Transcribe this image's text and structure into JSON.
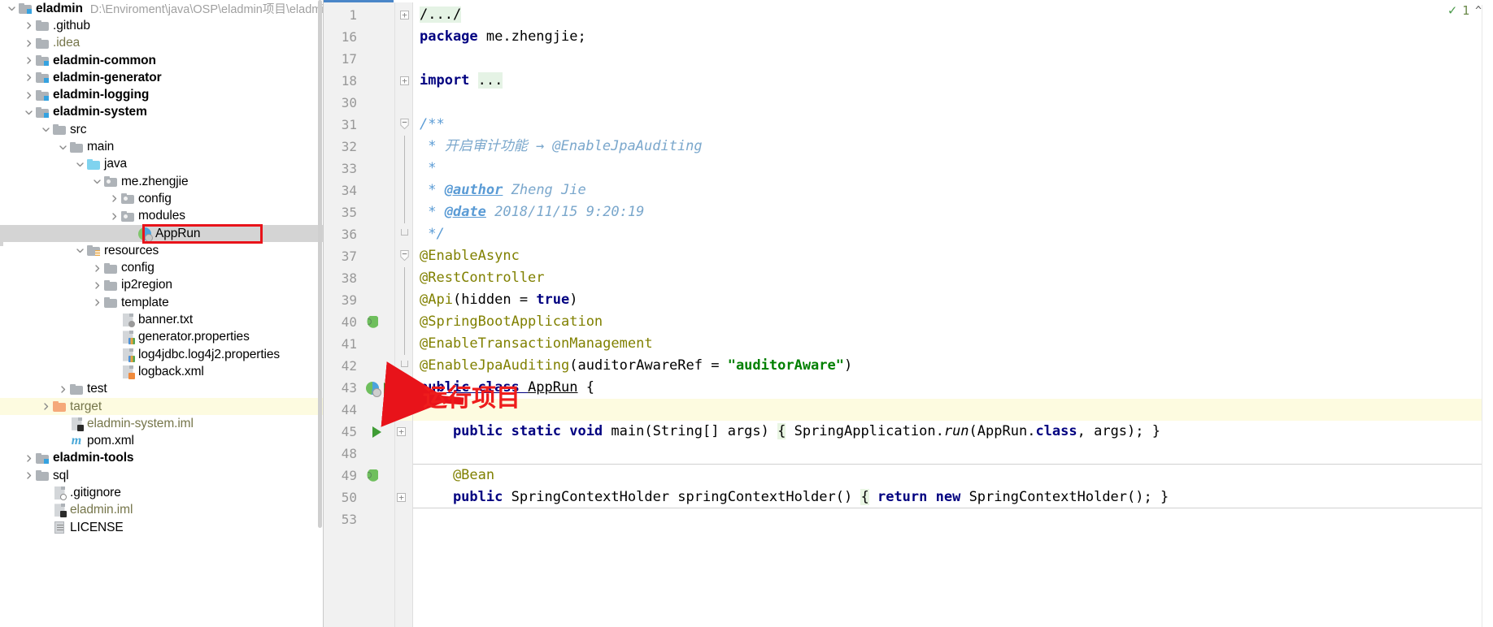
{
  "project_tree": {
    "root_path": "D:\\Enviroment\\java\\OSP\\eladmin项目\\eladmin\\e",
    "items": [
      {
        "label": "eladmin",
        "indent": 0,
        "arrow": "down",
        "icon": "module-folder",
        "style": "bold",
        "path": "D:\\Enviroment\\java\\OSP\\eladmin项目\\eladmin\\e"
      },
      {
        "label": ".github",
        "indent": 1,
        "arrow": "right",
        "icon": "folder",
        "style": "plain"
      },
      {
        "label": ".idea",
        "indent": 1,
        "arrow": "right",
        "icon": "folder",
        "style": "olive"
      },
      {
        "label": "eladmin-common",
        "indent": 1,
        "arrow": "right",
        "icon": "module-folder",
        "style": "bold"
      },
      {
        "label": "eladmin-generator",
        "indent": 1,
        "arrow": "right",
        "icon": "module-folder",
        "style": "bold"
      },
      {
        "label": "eladmin-logging",
        "indent": 1,
        "arrow": "right",
        "icon": "module-folder",
        "style": "bold"
      },
      {
        "label": "eladmin-system",
        "indent": 1,
        "arrow": "down",
        "icon": "module-folder",
        "style": "bold"
      },
      {
        "label": "src",
        "indent": 2,
        "arrow": "down",
        "icon": "folder",
        "style": "plain"
      },
      {
        "label": "main",
        "indent": 3,
        "arrow": "down",
        "icon": "folder",
        "style": "plain"
      },
      {
        "label": "java",
        "indent": 4,
        "arrow": "down",
        "icon": "source-folder",
        "style": "plain"
      },
      {
        "label": "me.zhengjie",
        "indent": 5,
        "arrow": "down",
        "icon": "package",
        "style": "plain"
      },
      {
        "label": "config",
        "indent": 6,
        "arrow": "right",
        "icon": "package",
        "style": "plain"
      },
      {
        "label": "modules",
        "indent": 6,
        "arrow": "right",
        "icon": "package",
        "style": "plain"
      },
      {
        "label": "AppRun",
        "indent": 7,
        "arrow": "none",
        "icon": "java-class",
        "style": "plain",
        "selected": true,
        "highlighted_box": true
      },
      {
        "label": "resources",
        "indent": 4,
        "arrow": "down",
        "icon": "resource-folder",
        "style": "plain"
      },
      {
        "label": "config",
        "indent": 5,
        "arrow": "right",
        "icon": "folder",
        "style": "plain"
      },
      {
        "label": "ip2region",
        "indent": 5,
        "arrow": "right",
        "icon": "folder",
        "style": "plain"
      },
      {
        "label": "template",
        "indent": 5,
        "arrow": "right",
        "icon": "folder",
        "style": "plain"
      },
      {
        "label": "banner.txt",
        "indent": 6,
        "arrow": "none",
        "icon": "text-file",
        "style": "plain"
      },
      {
        "label": "generator.properties",
        "indent": 6,
        "arrow": "none",
        "icon": "properties-file",
        "style": "plain"
      },
      {
        "label": "log4jdbc.log4j2.properties",
        "indent": 6,
        "arrow": "none",
        "icon": "properties-file",
        "style": "plain"
      },
      {
        "label": "logback.xml",
        "indent": 6,
        "arrow": "none",
        "icon": "xml-file",
        "style": "plain"
      },
      {
        "label": "test",
        "indent": 3,
        "arrow": "right",
        "icon": "folder",
        "style": "plain"
      },
      {
        "label": "target",
        "indent": 2,
        "arrow": "right",
        "icon": "excluded-folder",
        "style": "olive",
        "row_highlight": true
      },
      {
        "label": "eladmin-system.iml",
        "indent": 3,
        "arrow": "none",
        "icon": "module-file",
        "style": "olive"
      },
      {
        "label": "pom.xml",
        "indent": 3,
        "arrow": "none",
        "icon": "maven-file",
        "style": "plain"
      },
      {
        "label": "eladmin-tools",
        "indent": 1,
        "arrow": "right",
        "icon": "module-folder",
        "style": "bold"
      },
      {
        "label": "sql",
        "indent": 1,
        "arrow": "right",
        "icon": "folder",
        "style": "plain"
      },
      {
        "label": ".gitignore",
        "indent": 2,
        "arrow": "none",
        "icon": "gitignore-file",
        "style": "plain"
      },
      {
        "label": "eladmin.iml",
        "indent": 2,
        "arrow": "none",
        "icon": "module-file",
        "style": "olive"
      },
      {
        "label": "LICENSE",
        "indent": 2,
        "arrow": "none",
        "icon": "license-file",
        "style": "plain"
      }
    ]
  },
  "editor": {
    "inspection": {
      "count": "1",
      "check_icon": "check-mark-icon",
      "caret_icon": "chevron-up-icon"
    },
    "lines": [
      {
        "num": "1",
        "fold": "plus",
        "tokens": [
          {
            "t": "/.../",
            "c": "fold"
          }
        ]
      },
      {
        "num": "16",
        "fold": "none",
        "tokens": [
          {
            "t": "package ",
            "c": "kw"
          },
          {
            "t": "me.zhengjie;",
            "c": "plain"
          }
        ]
      },
      {
        "num": "17",
        "fold": "none",
        "tokens": []
      },
      {
        "num": "18",
        "fold": "plus",
        "tokens": [
          {
            "t": "import ",
            "c": "kw"
          },
          {
            "t": "...",
            "c": "fold"
          }
        ]
      },
      {
        "num": "30",
        "fold": "none",
        "tokens": []
      },
      {
        "num": "31",
        "fold": "minus-top",
        "tokens": [
          {
            "t": "/**",
            "c": "jd"
          }
        ]
      },
      {
        "num": "32",
        "fold": "bar",
        "tokens": [
          {
            "t": " * ",
            "c": "jd"
          },
          {
            "t": "开启审计功能 → @EnableJpaAuditing",
            "c": "jdplain"
          }
        ]
      },
      {
        "num": "33",
        "fold": "bar",
        "tokens": [
          {
            "t": " * ",
            "c": "jd"
          }
        ]
      },
      {
        "num": "34",
        "fold": "bar",
        "tokens": [
          {
            "t": " * ",
            "c": "jd"
          },
          {
            "t": "@author",
            "c": "jdtag"
          },
          {
            "t": " Zheng Jie",
            "c": "jdplain"
          }
        ]
      },
      {
        "num": "35",
        "fold": "bar",
        "tokens": [
          {
            "t": " * ",
            "c": "jd"
          },
          {
            "t": "@date",
            "c": "jdtag"
          },
          {
            "t": " 2018/11/15 9:20:19",
            "c": "jdplain"
          }
        ]
      },
      {
        "num": "36",
        "fold": "minus-end",
        "tokens": [
          {
            "t": " */",
            "c": "jd"
          }
        ]
      },
      {
        "num": "37",
        "fold": "minus-top",
        "tokens": [
          {
            "t": "@EnableAsync",
            "c": "ann"
          }
        ]
      },
      {
        "num": "38",
        "fold": "bar",
        "tokens": [
          {
            "t": "@RestController",
            "c": "ann"
          }
        ]
      },
      {
        "num": "39",
        "fold": "bar",
        "tokens": [
          {
            "t": "@Api",
            "c": "ann"
          },
          {
            "t": "(hidden = ",
            "c": "plain"
          },
          {
            "t": "true",
            "c": "kw"
          },
          {
            "t": ")",
            "c": "plain"
          }
        ]
      },
      {
        "num": "40",
        "fold": "bar",
        "gutter_icon": "bean-icon",
        "tokens": [
          {
            "t": "@SpringBootApplication",
            "c": "ann"
          }
        ]
      },
      {
        "num": "41",
        "fold": "bar",
        "tokens": [
          {
            "t": "@EnableTransactionManagement",
            "c": "ann"
          }
        ]
      },
      {
        "num": "42",
        "fold": "minus-end",
        "tokens": [
          {
            "t": "@EnableJpaAuditing",
            "c": "ann"
          },
          {
            "t": "(auditorAwareRef = ",
            "c": "plain"
          },
          {
            "t": "\"auditorAware\"",
            "c": "str"
          },
          {
            "t": ")",
            "c": "plain"
          }
        ]
      },
      {
        "num": "43",
        "fold": "none",
        "gutter_icon": "run-class-icon",
        "gutter_icon2": "run-play-icon",
        "tokens": [
          {
            "t": "public class ",
            "c": "kw-under"
          },
          {
            "t": "AppRun",
            "c": "plain-under"
          },
          {
            "t": " { ",
            "c": "plain"
          }
        ]
      },
      {
        "num": "44",
        "fold": "none",
        "row_highlight": true,
        "tokens": []
      },
      {
        "num": "45",
        "fold": "plus-indent",
        "gutter_icon2": "run-play-icon",
        "tokens": [
          {
            "t": "    public static void ",
            "c": "kw"
          },
          {
            "t": "main(String[] args) ",
            "c": "plain"
          },
          {
            "t": "{",
            "c": "brace"
          },
          {
            "t": " SpringApplication.",
            "c": "plain"
          },
          {
            "t": "run",
            "c": "ital"
          },
          {
            "t": "(AppRun.",
            "c": "plain"
          },
          {
            "t": "class",
            "c": "kw"
          },
          {
            "t": ", args); }",
            "c": "plain"
          }
        ]
      },
      {
        "num": "48",
        "fold": "none",
        "tokens": []
      },
      {
        "num": "49",
        "fold": "none",
        "separator_above": true,
        "gutter_icon": "bean-icon",
        "tokens": [
          {
            "t": "    @Bean",
            "c": "ann"
          }
        ]
      },
      {
        "num": "50",
        "fold": "plus-indent",
        "tokens": [
          {
            "t": "    public ",
            "c": "kw"
          },
          {
            "t": "SpringContextHolder springContextHolder() ",
            "c": "plain"
          },
          {
            "t": "{",
            "c": "brace"
          },
          {
            "t": " ",
            "c": "plain"
          },
          {
            "t": "return new ",
            "c": "kw"
          },
          {
            "t": "SpringContextHolder(); }",
            "c": "plain"
          }
        ]
      },
      {
        "num": "53",
        "fold": "none",
        "separator_above": true,
        "tokens": []
      }
    ]
  },
  "annotation": {
    "text": "运行项目",
    "arrow_color": "#e8131a",
    "text_color": "#ee1c1c",
    "box_color": "#e8131a"
  }
}
